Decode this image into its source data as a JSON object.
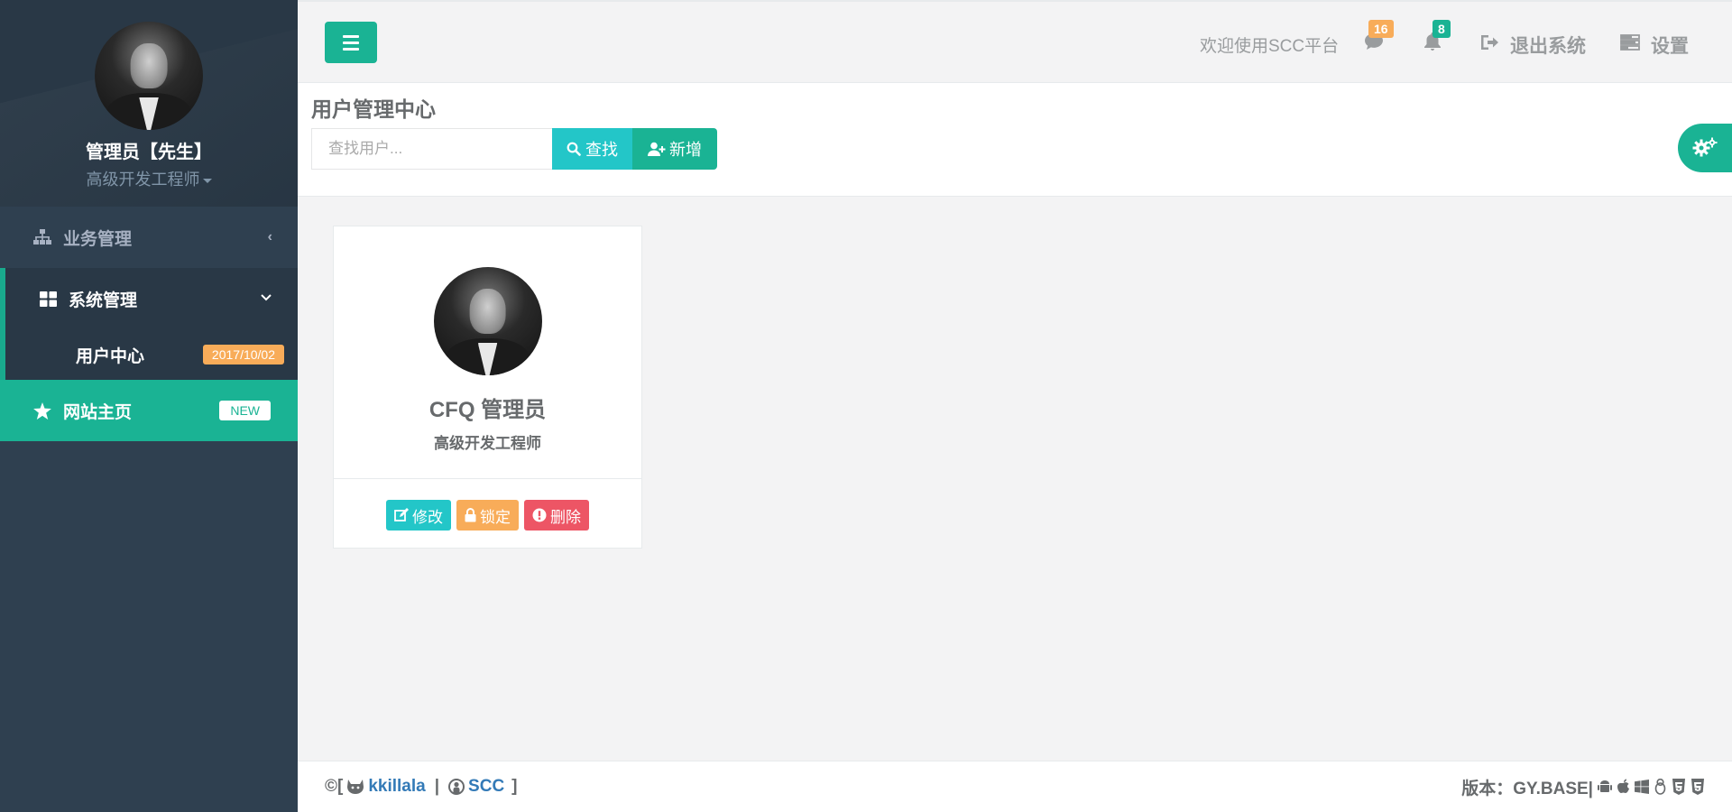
{
  "sidebar": {
    "profile": {
      "name": "管理员【先生】",
      "role": "高级开发工程师"
    },
    "nav": {
      "business": "业务管理",
      "system": "系统管理",
      "user_center": "用户中心",
      "user_center_badge": "2017/10/02",
      "home": "网站主页",
      "home_badge": "NEW"
    }
  },
  "topbar": {
    "welcome": "欢迎使用SCC平台",
    "messages_count": "16",
    "alerts_count": "8",
    "logout": "退出系统",
    "settings": "设置"
  },
  "page": {
    "title": "用户管理中心",
    "search_placeholder": "查找用户...",
    "find_label": "查找",
    "add_label": "新增"
  },
  "user_card": {
    "name": "CFQ 管理员",
    "role": "高级开发工程师",
    "edit": "修改",
    "lock": "锁定",
    "delete": "删除"
  },
  "footer": {
    "copyright": "©[",
    "author": "kkillala",
    "sep": "|",
    "project": "SCC",
    "close": "]",
    "version": "版本：GY.BASE|"
  },
  "colors": {
    "primary": "#1ab394",
    "info": "#23c6c8",
    "warning": "#f8ac59",
    "danger": "#ed5565",
    "sidebar": "#2f4050"
  }
}
